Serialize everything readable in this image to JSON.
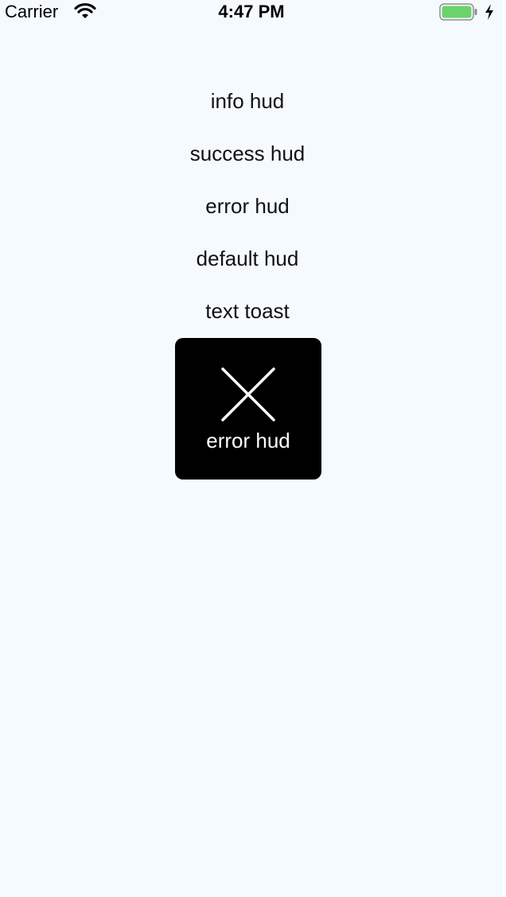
{
  "status_bar": {
    "carrier": "Carrier",
    "time": "4:47 PM",
    "battery_color": "#6cd36a"
  },
  "menu": {
    "items": [
      {
        "label": "info hud"
      },
      {
        "label": "success hud"
      },
      {
        "label": "error hud"
      },
      {
        "label": "default hud"
      },
      {
        "label": "text toast"
      }
    ]
  },
  "hud": {
    "icon": "close-icon",
    "label": "error hud",
    "background": "#000000"
  },
  "background_color": "#f5faff"
}
